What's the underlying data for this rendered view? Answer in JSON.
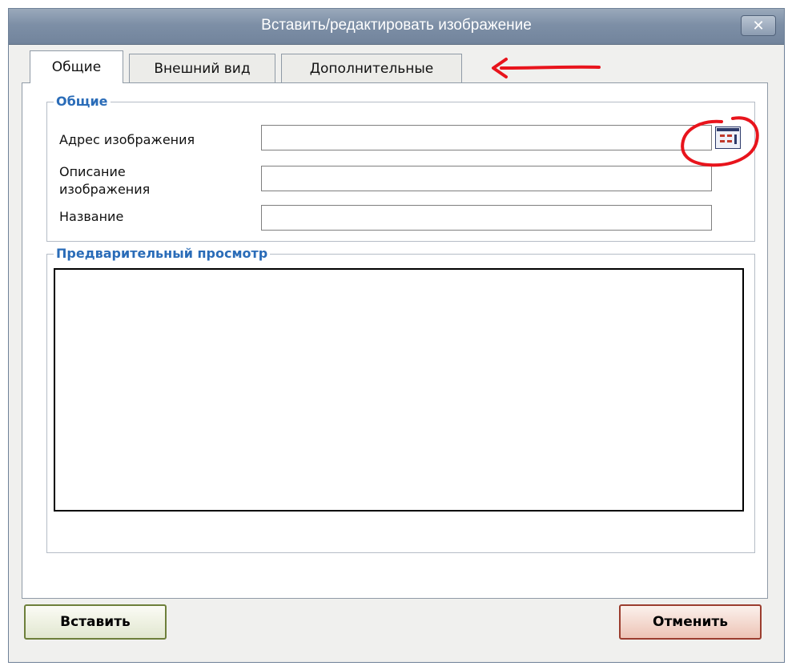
{
  "window": {
    "title": "Вставить/редактировать изображение",
    "close_symbol": "✕"
  },
  "tabs": [
    {
      "label": "Общие",
      "active": true
    },
    {
      "label": "Внешний вид",
      "active": false
    },
    {
      "label": "Дополнительные",
      "active": false
    }
  ],
  "general": {
    "legend": "Общие",
    "image_url_label": "Адрес изображения",
    "image_url_value": "",
    "description_label_line1": "Описание",
    "description_label_line2": "изображения",
    "description_value": "",
    "title_label": "Название",
    "title_value": "",
    "browse_icon": "browse-icon"
  },
  "preview": {
    "legend": "Предварительный просмотр"
  },
  "buttons": {
    "insert": "Вставить",
    "cancel": "Отменить"
  },
  "colors": {
    "legend": "#2a6cb8",
    "annotation": "#e8141c",
    "insert_border": "#6d7f3a",
    "cancel_border": "#9b3d2e"
  }
}
